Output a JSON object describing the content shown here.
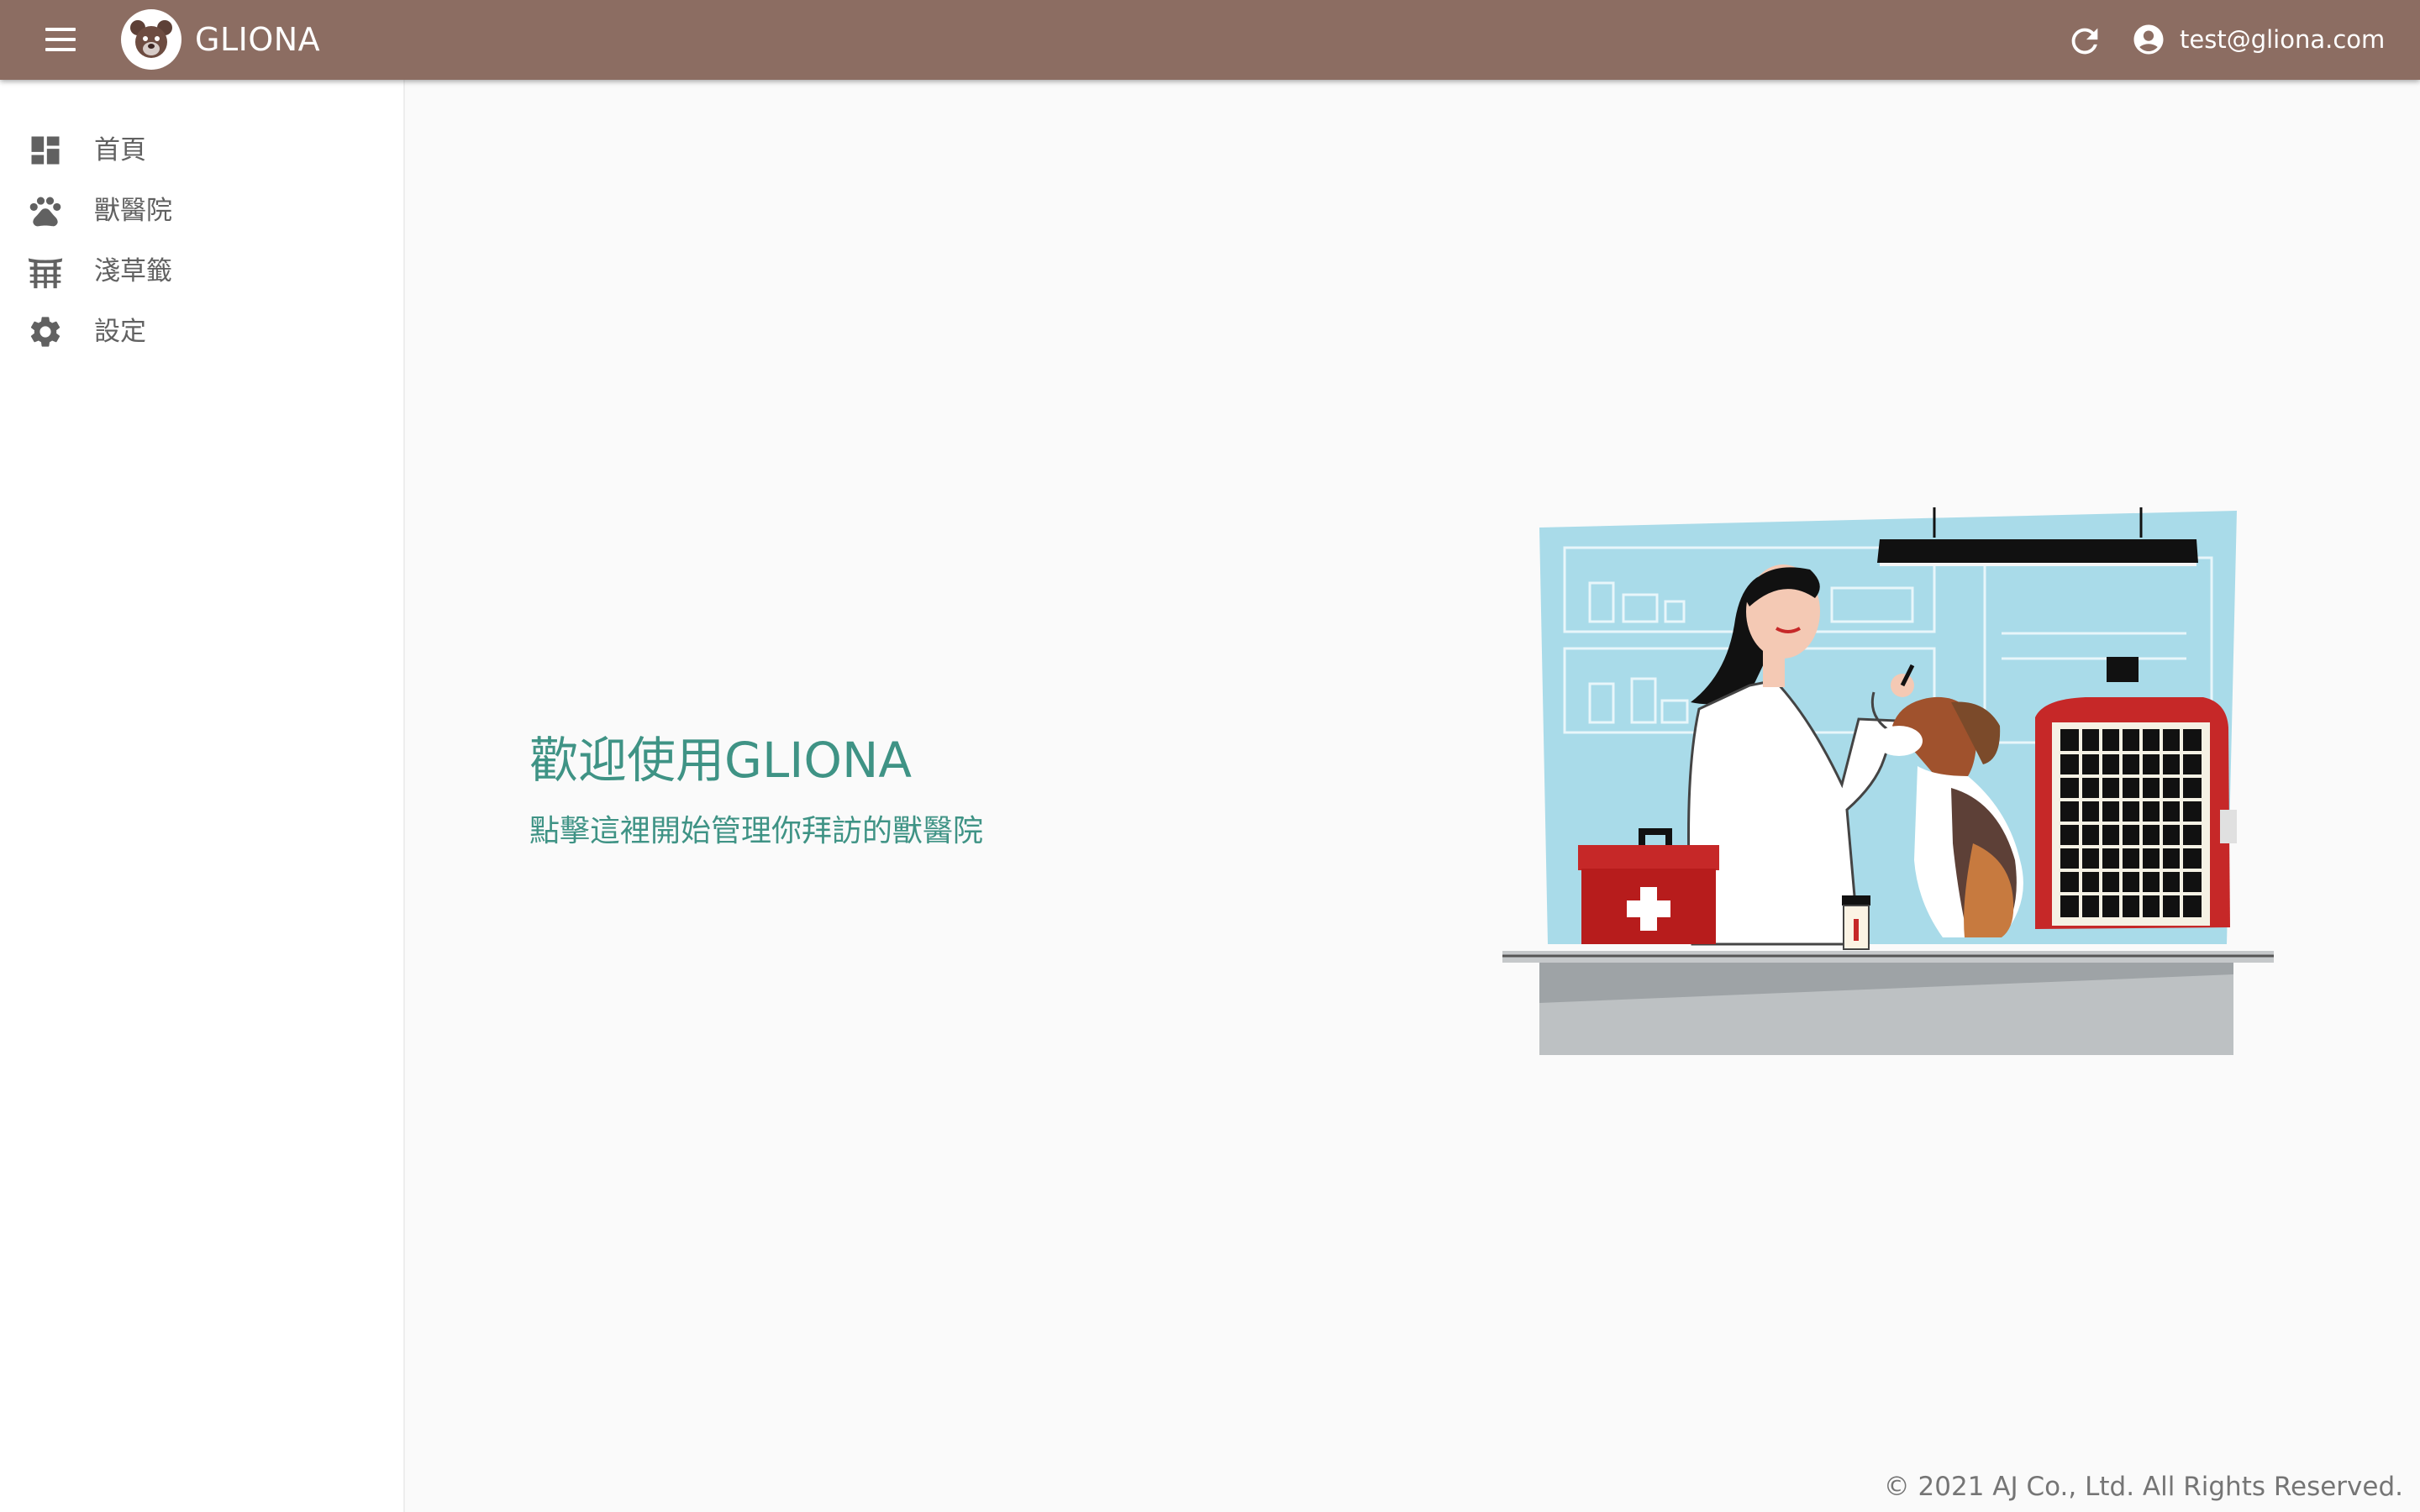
{
  "app": {
    "brand": "GLIONA",
    "user_email": "test@gliona.com"
  },
  "sidebar": {
    "items": [
      {
        "label": "首頁",
        "icon": "dashboard-icon"
      },
      {
        "label": "獸醫院",
        "icon": "paw-icon"
      },
      {
        "label": "淺草籤",
        "icon": "torii-gate-icon"
      },
      {
        "label": "設定",
        "icon": "gear-icon"
      }
    ]
  },
  "main": {
    "title": "歡迎使用GLIONA",
    "subtitle": "點擊這裡開始管理你拜訪的獸醫院"
  },
  "footer": {
    "copyright": "© 2021 AJ Co., Ltd. All Rights Reserved."
  },
  "colors": {
    "appbar": "#8c6d62",
    "accent": "#3f9385",
    "background": "#fafafa",
    "sidebar": "#ffffff"
  }
}
